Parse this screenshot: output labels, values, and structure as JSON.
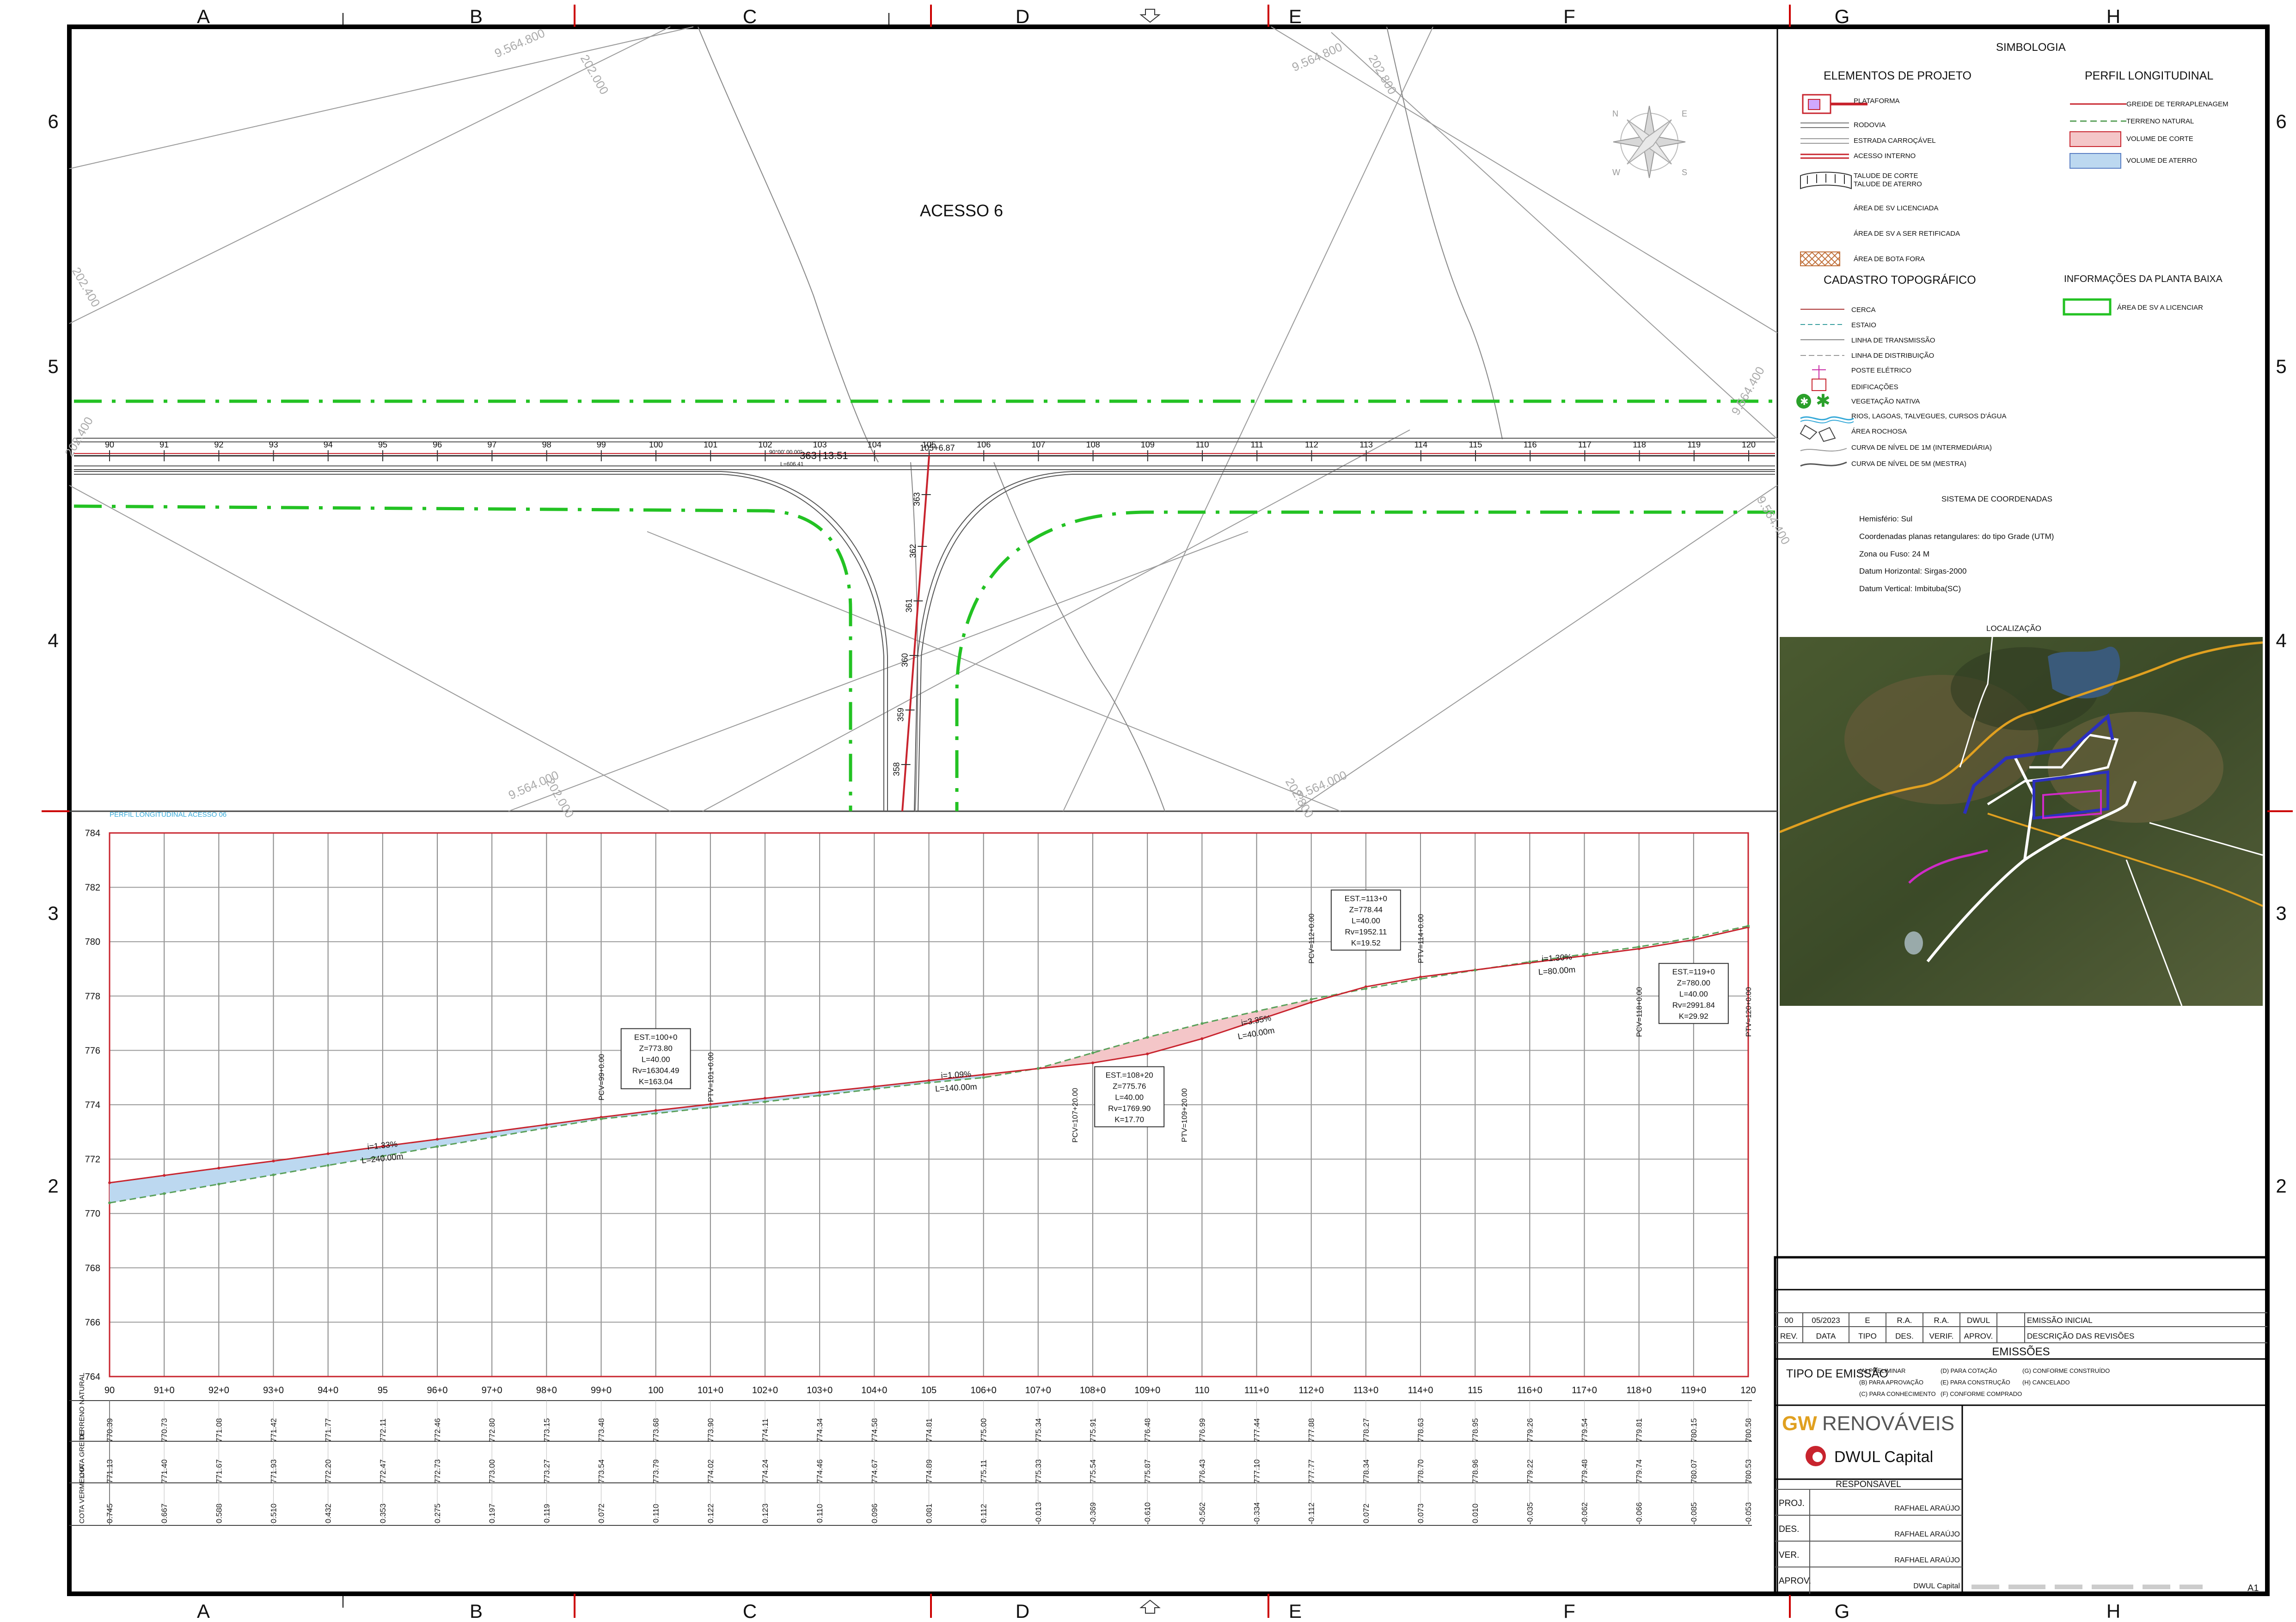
{
  "sheet": {
    "column_refs": [
      "A",
      "B",
      "C",
      "D",
      "E",
      "F",
      "G",
      "H"
    ],
    "row_refs": [
      "6",
      "5",
      "4",
      "3",
      "2"
    ]
  },
  "plan": {
    "title": "ACESSO 6",
    "top_stations": [
      "90",
      "91",
      "92",
      "93",
      "94",
      "95",
      "96",
      "97",
      "98",
      "99",
      "100",
      "101",
      "102",
      "103",
      "104",
      "105",
      "106",
      "107",
      "108",
      "109",
      "110",
      "111",
      "112",
      "113",
      "114",
      "115",
      "116",
      "117",
      "118",
      "119",
      "120"
    ],
    "access_stations": [
      "363",
      "362",
      "361",
      "360",
      "359",
      "358"
    ],
    "intersection_label": "363+13.51",
    "notes": [
      "90°00' 00.00\"",
      "L=606.41",
      "105+6.87"
    ],
    "coord_labels": [
      "9.564.800",
      "202.000",
      "9.564.800",
      "202.800",
      "202.400",
      "9.564.400",
      "202.400",
      "9.564.400",
      "9.564.000",
      "202.000",
      "9.564.000",
      "202.800"
    ]
  },
  "profile": {
    "title": "PERFIL LONGITUDINAL ACESSO 06",
    "y_ticks": [
      "784",
      "782",
      "780",
      "778",
      "776",
      "774",
      "772",
      "770",
      "768",
      "766",
      "764"
    ],
    "x_ticks": [
      "90",
      "91+0",
      "92+0",
      "93+0",
      "94+0",
      "95",
      "96+0",
      "97+0",
      "98+0",
      "99+0",
      "100",
      "101+0",
      "102+0",
      "103+0",
      "104+0",
      "105",
      "106+0",
      "107+0",
      "108+0",
      "109+0",
      "110",
      "111+0",
      "112+0",
      "113+0",
      "114+0",
      "115",
      "116+0",
      "117+0",
      "118+0",
      "119+0",
      "120"
    ],
    "row_labels": [
      "TERRENO NATURAL",
      "COTA GREIDE",
      "COTA VERMELHA"
    ],
    "terreno_natural": [
      "770.39",
      "770.73",
      "771.08",
      "771.42",
      "771.77",
      "772.11",
      "772.46",
      "772.80",
      "773.15",
      "773.48",
      "773.68",
      "773.90",
      "774.11",
      "774.34",
      "774.58",
      "774.81",
      "775.00",
      "775.34",
      "775.91",
      "776.48",
      "776.99",
      "777.44",
      "777.88",
      "778.27",
      "778.63",
      "778.95",
      "779.26",
      "779.54",
      "779.81",
      "780.15",
      "780.58"
    ],
    "cota_greide": [
      "771.13",
      "771.40",
      "771.67",
      "771.93",
      "772.20",
      "772.47",
      "772.73",
      "773.00",
      "773.27",
      "773.54",
      "773.79",
      "774.02",
      "774.24",
      "774.46",
      "774.67",
      "774.89",
      "775.11",
      "775.33",
      "775.54",
      "775.87",
      "776.43",
      "777.10",
      "777.77",
      "778.34",
      "778.70",
      "778.96",
      "779.22",
      "779.48",
      "779.74",
      "780.07",
      "780.53"
    ],
    "cota_vermelha": [
      "0.745",
      "0.667",
      "0.588",
      "0.510",
      "0.432",
      "0.353",
      "0.275",
      "0.197",
      "0.119",
      "0.072",
      "0.110",
      "0.122",
      "0.123",
      "0.110",
      "0.096",
      "0.081",
      "0.112",
      "-0.013",
      "-0.369",
      "-0.610",
      "-0.562",
      "-0.334",
      "-0.112",
      "0.072",
      "0.073",
      "0.010",
      "-0.035",
      "-0.062",
      "-0.066",
      "-0.085",
      "-0.053"
    ],
    "slopes": [
      {
        "i": "i=1.33%",
        "l": "L=240.00m"
      },
      {
        "i": "i=1.09%",
        "l": "L=140.00m"
      },
      {
        "i": "i=3.35%",
        "l": "L=40.00m"
      },
      {
        "i": "i=1.30%",
        "l": "L=80.00m"
      }
    ],
    "curves": [
      {
        "lines": [
          "EST.=100+0",
          "Z=773.80",
          "L=40.00",
          "Rv=16304.49",
          "K=163.04"
        ],
        "pcv": "PCV=99+0.00",
        "ptv": "PTV=101+0.00"
      },
      {
        "lines": [
          "EST.=108+20",
          "Z=775.76",
          "L=40.00",
          "Rv=1769.90",
          "K=17.70"
        ],
        "pcv": "PCV=107+20.00",
        "ptv": "PTV=109+20.00"
      },
      {
        "lines": [
          "EST.=113+0",
          "Z=778.44",
          "L=40.00",
          "Rv=1952.11",
          "K=19.52"
        ],
        "pcv": "PCV=112+0.00",
        "ptv": "PTV=114+0.00"
      },
      {
        "lines": [
          "EST.=119+0",
          "Z=780.00",
          "L=40.00",
          "Rv=2991.84",
          "K=29.92"
        ],
        "pcv": "PCV=118+0.00",
        "ptv": "PTV=120+0.00"
      }
    ]
  },
  "chart_data": {
    "type": "line",
    "title": "PERFIL LONGITUDINAL ACESSO 06",
    "x": [
      90,
      91,
      92,
      93,
      94,
      95,
      96,
      97,
      98,
      99,
      100,
      101,
      102,
      103,
      104,
      105,
      106,
      107,
      108,
      109,
      110,
      111,
      112,
      113,
      114,
      115,
      116,
      117,
      118,
      119,
      120
    ],
    "ylim": [
      764,
      784
    ],
    "series": [
      {
        "name": "TERRENO NATURAL",
        "values": [
          770.39,
          770.73,
          771.08,
          771.42,
          771.77,
          772.11,
          772.46,
          772.8,
          773.15,
          773.48,
          773.68,
          773.9,
          774.11,
          774.34,
          774.58,
          774.81,
          775.0,
          775.34,
          775.91,
          776.48,
          776.99,
          777.44,
          777.88,
          778.27,
          778.63,
          778.95,
          779.26,
          779.54,
          779.81,
          780.15,
          780.58
        ]
      },
      {
        "name": "COTA GREIDE",
        "values": [
          771.13,
          771.4,
          771.67,
          771.93,
          772.2,
          772.47,
          772.73,
          773.0,
          773.27,
          773.54,
          773.79,
          774.02,
          774.24,
          774.46,
          774.67,
          774.89,
          775.11,
          775.33,
          775.54,
          775.87,
          776.43,
          777.1,
          777.77,
          778.34,
          778.7,
          778.96,
          779.22,
          779.48,
          779.74,
          780.07,
          780.53
        ]
      }
    ],
    "colors": {
      "greide": "#c8242e",
      "terreno": "#5aa05a",
      "corte": "#f4c6c8",
      "aterro": "#bcd8f0"
    }
  },
  "legend": {
    "title": "SIMBOLOGIA",
    "proj_title": "ELEMENTOS DE PROJETO",
    "proj_items": [
      "PLATAFORMA",
      "RODOVIA",
      "ESTRADA CARROÇÁVEL",
      "ACESSO INTERNO",
      "TALUDE DE CORTE",
      "TALUDE DE ATERRO",
      "ÁREA DE SV LICENCIADA",
      "ÁREA DE SV A SER RETIFICADA",
      "ÁREA DE BOTA FORA"
    ],
    "perfil_title": "PERFIL LONGITUDINAL",
    "perfil_items": [
      "GREIDE DE TERRAPLENAGEM",
      "TERRENO NATURAL",
      "VOLUME DE CORTE",
      "VOLUME DE ATERRO"
    ],
    "cad_title": "CADASTRO TOPOGRÁFICO",
    "cad_items": [
      "CERCA",
      "ESTAIO",
      "LINHA DE TRANSMISSÃO",
      "LINHA DE DISTRIBUIÇÃO",
      "POSTE ELÉTRICO",
      "EDIFICAÇÕES",
      "VEGETAÇÃO NATIVA",
      "RIOS, LAGOAS, TALVEGUES, CURSOS D'ÁGUA",
      "ÁREA ROCHOSA",
      "CURVA DE NÍVEL DE 1M (INTERMEDIÁRIA)",
      "CURVA DE NÍVEL DE 5M (MESTRA)"
    ],
    "info_title": "INFORMAÇÕES DA PLANTA BAIXA",
    "info_items": [
      "ÁREA DE SV A LICENCIAR"
    ],
    "coord_title": "SISTEMA DE COORDENADAS",
    "coord_items": [
      "Hemisfério: Sul",
      "Coordenadas planas retangulares: do tipo Grade (UTM)",
      "Zona ou Fuso: 24 M",
      "Datum Horizontal: Sirgas-2000",
      "Datum Vertical: Imbituba(SC)"
    ],
    "loc_title": "LOCALIZAÇÃO"
  },
  "title_block": {
    "rev_row": [
      "00",
      "05/2023",
      "E",
      "R.A.",
      "R.A.",
      "DWUL",
      "EMISSÃO INICIAL"
    ],
    "rev_headers": [
      "REV.",
      "DATA",
      "TIPO",
      "DES.",
      "VERIF.",
      "APROV.",
      "DESCRIÇÃO DAS REVISÕES"
    ],
    "emissoes": "EMISSÕES",
    "tipo_label": "TIPO DE EMISSÃO",
    "tipo_opts": [
      "(A) PRELIMINAR",
      "(B) PARA APROVAÇÃO",
      "(C) PARA CONHECIMENTO",
      "(D) PARA COTAÇÃO",
      "(E) PARA CONSTRUÇÃO",
      "(F) CONFORME COMPRADO",
      "(G) CONFORME CONSTRUÍDO",
      "(H) CANCELADO"
    ],
    "company1_a": "GW",
    "company1_b": "RENOVÁVEIS",
    "company2": "DWUL Capital",
    "responsavel": "RESPONSÁVEL",
    "roles": [
      {
        "k": "PROJ.",
        "v": "RAFHAEL ARAÚJO"
      },
      {
        "k": "DES.",
        "v": "RAFHAEL ARAÚJO"
      },
      {
        "k": "VER.",
        "v": "RAFHAEL ARAÚJO"
      },
      {
        "k": "APROV.",
        "v": "DWUL Capital"
      }
    ],
    "format": "A1"
  }
}
